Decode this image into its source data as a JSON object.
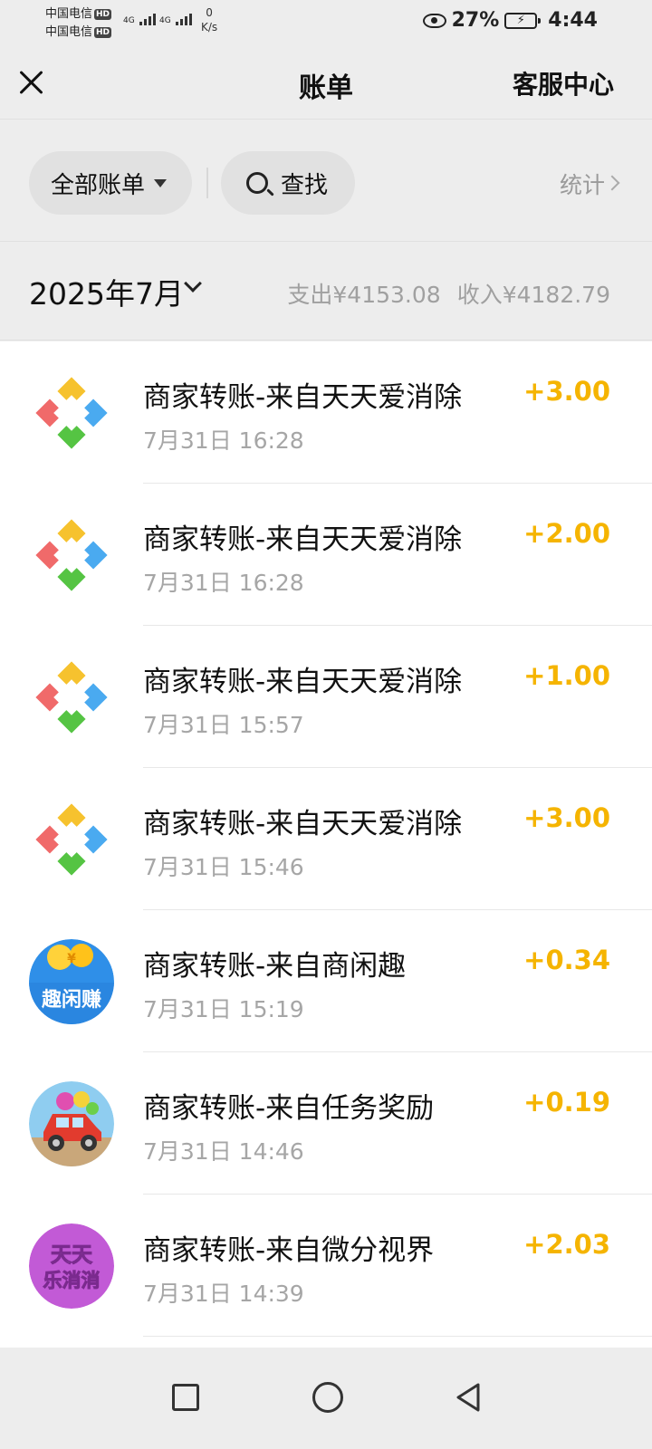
{
  "status_bar": {
    "carrier1": "中国电信",
    "carrier2": "中国电信",
    "hd1": "HD",
    "hd2": "HD",
    "network1": "4G",
    "network2": "4G",
    "speed_value": "0",
    "speed_unit": "K/s",
    "battery": "27%",
    "time": "4:44"
  },
  "navbar": {
    "title": "账单",
    "service": "客服中心"
  },
  "filters": {
    "all_bills": "全部账单",
    "search": "查找",
    "stats": "统计"
  },
  "month_bar": {
    "month": "2025年7月",
    "expense": "支出¥4153.08",
    "income": "收入¥4182.79"
  },
  "transactions": [
    {
      "title": "商家转账-来自天天爱消除",
      "time": "7月31日 16:28",
      "amount": "+3.00",
      "icon": "game-diamond-icon"
    },
    {
      "title": "商家转账-来自天天爱消除",
      "time": "7月31日 16:28",
      "amount": "+2.00",
      "icon": "game-diamond-icon"
    },
    {
      "title": "商家转账-来自天天爱消除",
      "time": "7月31日 15:57",
      "amount": "+1.00",
      "icon": "game-diamond-icon"
    },
    {
      "title": "商家转账-来自天天爱消除",
      "time": "7月31日 15:46",
      "amount": "+3.00",
      "icon": "game-diamond-icon"
    },
    {
      "title": "商家转账-来自商闲趣",
      "time": "7月31日 15:19",
      "amount": "+0.34",
      "icon": "quxianzhuan-icon",
      "icon_text": "趣闲赚"
    },
    {
      "title": "商家转账-来自任务奖励",
      "time": "7月31日 14:46",
      "amount": "+0.19",
      "icon": "red-car-icon"
    },
    {
      "title": "商家转账-来自微分视界",
      "time": "7月31日 14:39",
      "amount": "+2.03",
      "icon": "tiantian-icon",
      "icon_text_1": "天天",
      "icon_text_2": "乐消消"
    }
  ],
  "colors": {
    "amount": "#f5b400",
    "background": "#ededed"
  }
}
